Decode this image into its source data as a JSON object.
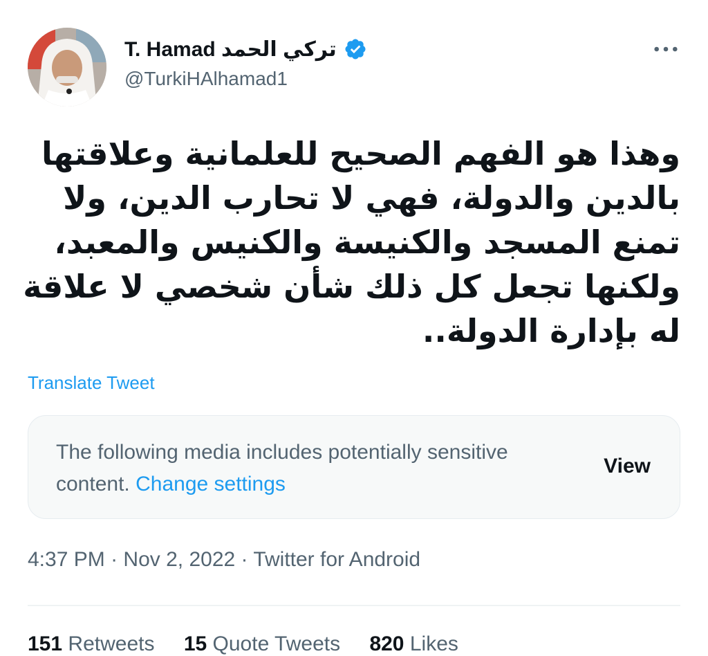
{
  "author": {
    "display_name": "T. Hamad تركي الحمد",
    "handle": "@TurkiHAlhamad1",
    "verified": true,
    "avatar_icon": "profile-photo"
  },
  "more_icon": "more-horizontal-icon",
  "tweet": {
    "lines": [
      "وهذا هو الفهم الصحيح للعلمانية وعلاقتها",
      "بالدين والدولة، فهي لا تحارب الدين، ولا",
      "تمنع المسجد والكنيسة والكنيس والمعبد،",
      "ولكنها تجعل كل ذلك شأن شخصي لا علاقة",
      "له بإدارة الدولة.."
    ]
  },
  "translate_label": "Translate Tweet",
  "sensitive_media": {
    "text": "The following media includes potentially sensitive content.",
    "link": "Change settings",
    "button": "View"
  },
  "meta": {
    "time": "4:37 PM",
    "date": "Nov 2, 2022",
    "source": "Twitter for Android",
    "separator": " · "
  },
  "stats": {
    "retweets_count": "151",
    "retweets_label": "Retweets",
    "quotes_count": "15",
    "quotes_label": "Quote Tweets",
    "likes_count": "820",
    "likes_label": "Likes"
  },
  "colors": {
    "accent": "#1d9bf0",
    "secondary_text": "#536471",
    "primary_text": "#0f1419"
  }
}
